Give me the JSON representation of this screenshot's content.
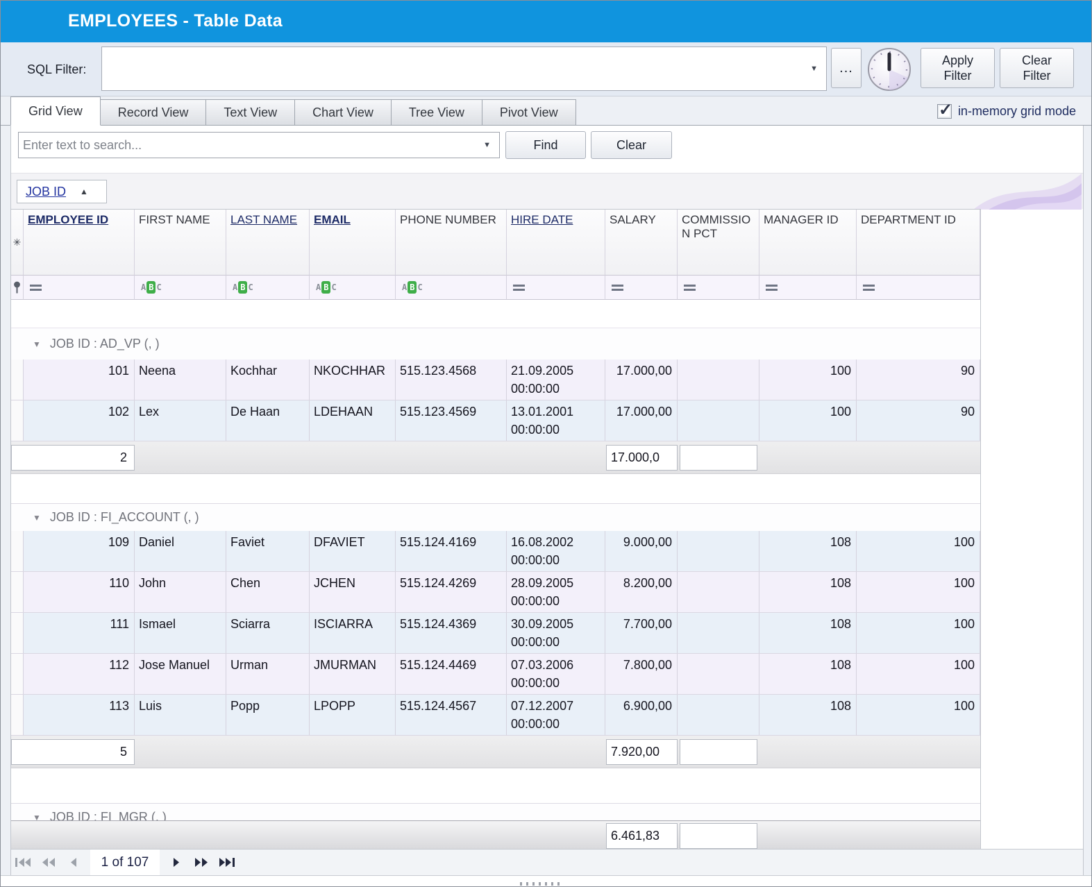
{
  "window": {
    "title": "EMPLOYEES - Table Data"
  },
  "filter_bar": {
    "label": "SQL Filter:",
    "value": "",
    "ellipsis_button": "...",
    "apply_button": "Apply Filter",
    "clear_button": "Clear Filter"
  },
  "view_tabs": {
    "tabs": [
      "Grid View",
      "Record View",
      "Text View",
      "Chart View",
      "Tree View",
      "Pivot View"
    ],
    "active": "Grid View"
  },
  "grid_mode": {
    "label": "in-memory grid mode",
    "checked": true
  },
  "search_bar": {
    "placeholder": "Enter text to search...",
    "find_button": "Find",
    "clear_button": "Clear"
  },
  "group_panel": {
    "field": "JOB ID",
    "sort_direction": "ascending"
  },
  "grid": {
    "columns": [
      {
        "label": "EMPLOYEE ID",
        "header_style": "key",
        "filter_icon": "equals",
        "align": "right"
      },
      {
        "label": "FIRST NAME",
        "header_style": "plain",
        "filter_icon": "abc",
        "align": "left"
      },
      {
        "label": "LAST NAME",
        "header_style": "link",
        "filter_icon": "abc",
        "align": "left"
      },
      {
        "label": "EMAIL",
        "header_style": "key",
        "filter_icon": "abc",
        "align": "left"
      },
      {
        "label": "PHONE NUMBER",
        "header_style": "plain",
        "filter_icon": "abc",
        "align": "left"
      },
      {
        "label": "HIRE DATE",
        "header_style": "link",
        "filter_icon": "equals",
        "align": "left"
      },
      {
        "label": "SALARY",
        "header_style": "plain",
        "filter_icon": "equals",
        "align": "right"
      },
      {
        "label": "COMMISSION PCT",
        "header_style": "plain",
        "filter_icon": "equals",
        "align": "right"
      },
      {
        "label": "MANAGER ID",
        "header_style": "plain",
        "filter_icon": "equals",
        "align": "right"
      },
      {
        "label": "DEPARTMENT ID",
        "header_style": "plain",
        "filter_icon": "equals",
        "align": "right"
      }
    ],
    "groups": [
      {
        "label": "JOB ID : AD_VP (, )",
        "stripe_offset": 0,
        "rows": [
          [
            "101",
            "Neena",
            "Kochhar",
            "NKOCHHAR",
            "515.123.4568",
            "21.09.2005 00:00:00",
            "17.000,00",
            "",
            "100",
            "90"
          ],
          [
            "102",
            "Lex",
            "De Haan",
            "LDEHAAN",
            "515.123.4569",
            "13.01.2001 00:00:00",
            "17.000,00",
            "",
            "100",
            "90"
          ]
        ],
        "summary": {
          "count": "2",
          "salary": "17.000,0",
          "commission": ""
        }
      },
      {
        "label": "JOB ID : FI_ACCOUNT (, )",
        "stripe_offset": 1,
        "rows": [
          [
            "109",
            "Daniel",
            "Faviet",
            "DFAVIET",
            "515.124.4169",
            "16.08.2002 00:00:00",
            "9.000,00",
            "",
            "108",
            "100"
          ],
          [
            "110",
            "John",
            "Chen",
            "JCHEN",
            "515.124.4269",
            "28.09.2005 00:00:00",
            "8.200,00",
            "",
            "108",
            "100"
          ],
          [
            "111",
            "Ismael",
            "Sciarra",
            "ISCIARRA",
            "515.124.4369",
            "30.09.2005 00:00:00",
            "7.700,00",
            "",
            "108",
            "100"
          ],
          [
            "112",
            "Jose Manuel",
            "Urman",
            "JMURMAN",
            "515.124.4469",
            "07.03.2006 00:00:00",
            "7.800,00",
            "",
            "108",
            "100"
          ],
          [
            "113",
            "Luis",
            "Popp",
            "LPOPP",
            "515.124.4567",
            "07.12.2007 00:00:00",
            "6.900,00",
            "",
            "108",
            "100"
          ]
        ],
        "summary": {
          "count": "5",
          "salary": "7.920,00",
          "commission": ""
        }
      },
      {
        "label": "JOB ID : FI_MGR (, )",
        "stripe_offset": 0,
        "rows": [],
        "summary": null
      }
    ],
    "total_summary": {
      "salary": "6.461,83",
      "commission": ""
    }
  },
  "pager": {
    "position": "1 of 107"
  },
  "colors": {
    "titlebar": "#1094DE",
    "abc_green": "#3FAE49",
    "stripe_a": "#F3F0FA",
    "stripe_b": "#E9F0F8"
  }
}
